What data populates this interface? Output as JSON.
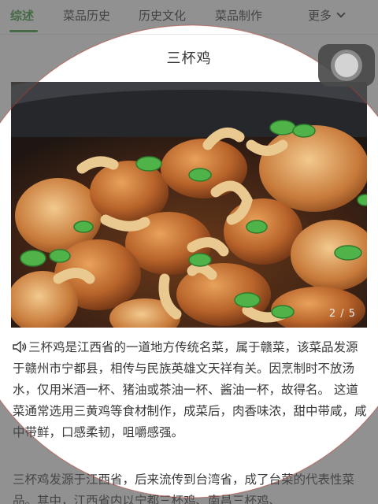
{
  "tabs": [
    {
      "label": "综述",
      "active": true
    },
    {
      "label": "菜品历史",
      "active": false
    },
    {
      "label": "历史文化",
      "active": false
    },
    {
      "label": "菜品制作",
      "active": false
    }
  ],
  "more_label": "更多",
  "title": "三杯鸡",
  "image": {
    "counter": "2 / 5"
  },
  "paragraphs": [
    "三杯鸡是江西省的一道地方传统名菜，属于赣菜，该菜品发源于赣州市宁都县，相传与民族英雄文天祥有关。因烹制时不放汤水，仅用米酒一杯、猪油或茶油一杯、酱油一杯，故得名。 这道菜通常选用三黄鸡等食材制作，成菜后，肉香味浓，甜中带咸，咸中带鲜，口感柔韧，咀嚼感强。",
    "三杯鸡发源于江西省，后来流传到台湾省，成了台菜的代表性菜品。其中，江西省内以宁都三杯鸡、南昌三杯鸡、"
  ],
  "colors": {
    "accent": "#3e9a3a",
    "vignette": "#4d4d4d"
  },
  "icons": {
    "speaker": "speaker-icon",
    "more": "chevron-down-icon",
    "floating": "assistive-touch-icon"
  }
}
